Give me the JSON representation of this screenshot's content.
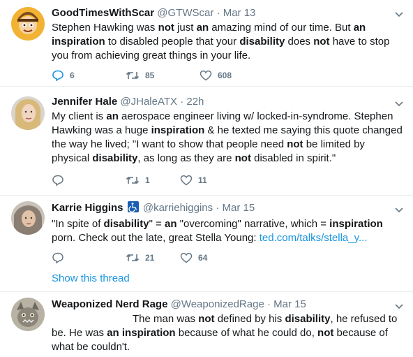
{
  "tweets": [
    {
      "name": "GoodTimesWithScar",
      "handle": "@GTWScar",
      "time": "Mar 13",
      "text_html": "Stephen Hawking was <b>not</b> just <b>an</b> amazing mind of our time. But <b>an inspiration</b> to disabled people that your <b>disability</b> does <b>not</b> have to stop you from achieving great things in your life.",
      "replies": "6",
      "retweets": "85",
      "likes": "608"
    },
    {
      "name": "Jennifer Hale",
      "handle": "@JHaleATX",
      "time": "22h",
      "text_html": "My client is <b>an</b> aerospace engineer living w/ locked-in-syndrome. Stephen Hawking was a huge <b>inspiration</b> &amp; he texted me saying this quote changed the way he lived; \"I want to show that people need <b>not</b> be limited by physical <b>disability</b>, as long as they are <b>not</b> disabled in spirit.\"",
      "replies": "",
      "retweets": "1",
      "likes": "11"
    },
    {
      "name": "Karrie Higgins",
      "handle": "@karriehiggins",
      "time": "Mar 15",
      "text_html": "\"In spite of <b>disability</b>\" = <b>an</b> \"overcoming\" narrative, which = <b>inspiration</b> porn. Check out the late, great Stella Young: <span class=\"link\">ted.com/talks/stella_y...</span>",
      "replies": "",
      "retweets": "21",
      "likes": "64",
      "show_thread": "Show this thread"
    },
    {
      "name": "Weaponized Nerd Rage",
      "handle": "@WeaponizedRage",
      "time": "Mar 15",
      "text_html": "<span style=\"display:inline-block;width:116px\"></span>The man was <b>not</b> defined by his <b>disability</b>, he refused to be. He was <b>an inspiration</b> because of what he could do, <b>not</b> because of what be couldn't."
    }
  ],
  "dot": "·",
  "colors": {
    "link": "#1b95e0",
    "muted": "#657786",
    "text": "#14171a",
    "divider": "#e6ecf0"
  }
}
